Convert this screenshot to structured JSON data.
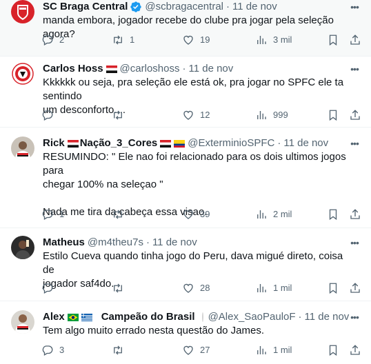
{
  "tweets": [
    {
      "name": "SC Braga Central",
      "handle": "@scbragacentral",
      "date": "11 de nov",
      "text": "manda embora, jogador recebe do clube pra jogar pela seleção agora?",
      "replies": "2",
      "retweets": "1",
      "likes": "19",
      "views": "3 mil"
    },
    {
      "name": "Carlos Hoss",
      "handle": "@carloshoss",
      "date": "11 de nov",
      "text": "Kkkkkk ou seja, pra seleção ele está ok, pra jogar no SPFC ele ta sentindo\num desconforto....",
      "replies": "",
      "retweets": "",
      "likes": "12",
      "views": "999"
    },
    {
      "name": "Rick",
      "name_mid": "Nação_3_Cores",
      "handle": "@ExterminioSPFC",
      "date": "11 de nov",
      "text": "RESUMINDO: \" Ele nao foi relacionado para os dois ultimos jogos para\nchegar 100% na seleçao \"\n\nNada me tira da cabeça essa visao.",
      "replies": "1",
      "retweets": "",
      "likes": "39",
      "views": "2 mil"
    },
    {
      "name": "Matheus",
      "handle": "@m4theu7s",
      "date": "11 de nov",
      "text": "Estilo Cueva quando tinha jogo do Peru, dava migué direto, coisa de\njogador saf4do.",
      "replies": "",
      "retweets": "",
      "likes": "28",
      "views": "1 mil"
    },
    {
      "name": "Alex",
      "name_mid": "Campeão do Brasil",
      "handle": "@Alex_SaoPauloF",
      "date": "11 de nov",
      "text": "Tem algo muito errado nesta questão do James.",
      "replies": "3",
      "retweets": "",
      "likes": "27",
      "views": "1 mil"
    }
  ],
  "ui": {
    "dot": "·",
    "more": "•••"
  },
  "colors": {
    "text": "#0f1419",
    "secondary": "#536471",
    "verified": "#1d9bf0",
    "divider": "#eff3f4",
    "highlight_bg": "#f7f9f9"
  },
  "icons": {
    "reply": "reply-icon",
    "retweet": "retweet-icon",
    "like": "heart-icon",
    "views": "views-chart-icon",
    "bookmark": "bookmark-icon",
    "share": "share-icon",
    "more": "more-options-icon",
    "verified": "verified-badge-icon"
  }
}
